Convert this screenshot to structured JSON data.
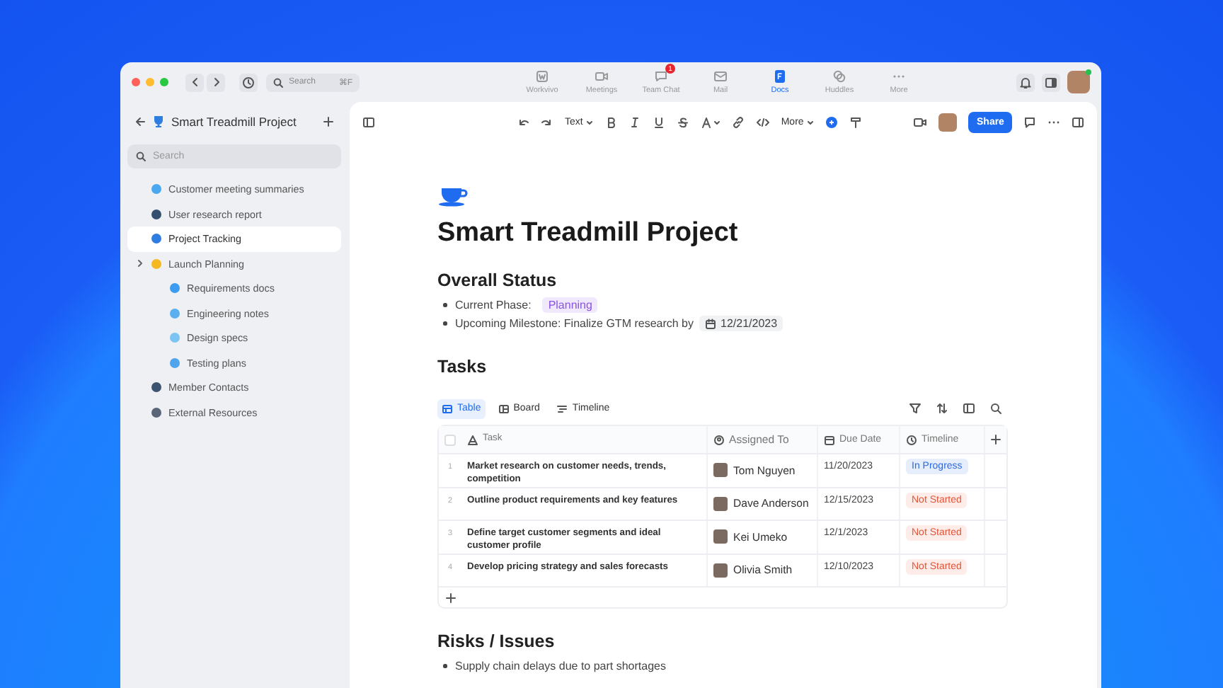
{
  "titlebar": {
    "search": {
      "placeholder": "Search",
      "shortcut": "⌘F"
    },
    "nav": [
      {
        "label": "Workvivo",
        "selected": false
      },
      {
        "label": "Meetings",
        "selected": false
      },
      {
        "label": "Team Chat",
        "selected": false,
        "badge": "1"
      },
      {
        "label": "Mail",
        "selected": false
      },
      {
        "label": "Docs",
        "selected": true
      },
      {
        "label": "Huddles",
        "selected": false
      },
      {
        "label": "More",
        "selected": false
      }
    ]
  },
  "sidebar": {
    "title": "Smart Treadmill Project",
    "search": {
      "placeholder": "Search"
    },
    "items": [
      {
        "label": "Customer meeting summaries",
        "color": "#4aa8f0",
        "selected": false
      },
      {
        "label": "User research report",
        "color": "#34506e",
        "selected": false
      },
      {
        "label": "Project Tracking",
        "color": "#2f7de1",
        "selected": true
      },
      {
        "label": "Launch Planning",
        "color": "#f5b820",
        "selected": false,
        "children": [
          {
            "label": "Requirements docs",
            "color": "#3b9cf0",
            "selected": false
          },
          {
            "label": "Engineering notes",
            "color": "#5ab0ee",
            "selected": false
          },
          {
            "label": "Design specs",
            "color": "#7cc4f2",
            "selected": false
          },
          {
            "label": "Testing plans",
            "color": "#4fa4ec",
            "selected": false
          }
        ]
      },
      {
        "label": "Member Contacts",
        "color": "#3d5470",
        "selected": false
      },
      {
        "label": "External Resources",
        "color": "#5a6678",
        "selected": false
      }
    ]
  },
  "toolbar": {
    "text_style": "Text",
    "more": "More",
    "share": "Share"
  },
  "document": {
    "title": "Smart Treadmill Project",
    "sections": [
      {
        "heading": "Overall Status",
        "kind": "status",
        "bullets": [
          {
            "text": "Current Phase:",
            "tag": "Planning"
          },
          {
            "text": "Upcoming Milestone: Finalize GTM research by",
            "date": "12/21/2023"
          }
        ]
      },
      {
        "heading": "Tasks",
        "kind": "table",
        "views": [
          {
            "label": "Table",
            "selected": true
          },
          {
            "label": "Board",
            "selected": false
          },
          {
            "label": "Timeline",
            "selected": false
          }
        ],
        "select_all_checked": false,
        "columns": [
          "Task",
          "Assigned To",
          "Due Date",
          "Timeline"
        ],
        "rows": [
          {
            "number": "1",
            "task": "Market research on customer needs, trends, competition",
            "assignee": "Tom Nguyen",
            "due": "11/20/2023",
            "status": "In Progress",
            "kind": "in_progress"
          },
          {
            "number": "2",
            "task": "Outline product requirements and key features",
            "assignee": "Dave Anderson",
            "due": "12/15/2023",
            "status": "Not Started",
            "kind": "not_started"
          },
          {
            "number": "3",
            "task": "Define target customer segments and ideal customer profile",
            "assignee": "Kei Umeko",
            "due": "12/1/2023",
            "status": "Not Started",
            "kind": "not_started"
          },
          {
            "number": "4",
            "task": "Develop pricing strategy and sales forecasts",
            "assignee": "Olivia Smith",
            "due": "12/10/2023",
            "status": "Not Started",
            "kind": "not_started"
          }
        ]
      },
      {
        "heading": "Risks / Issues",
        "kind": "list",
        "bullets": [
          {
            "text": "Supply chain delays due to part shortages"
          }
        ]
      }
    ]
  }
}
